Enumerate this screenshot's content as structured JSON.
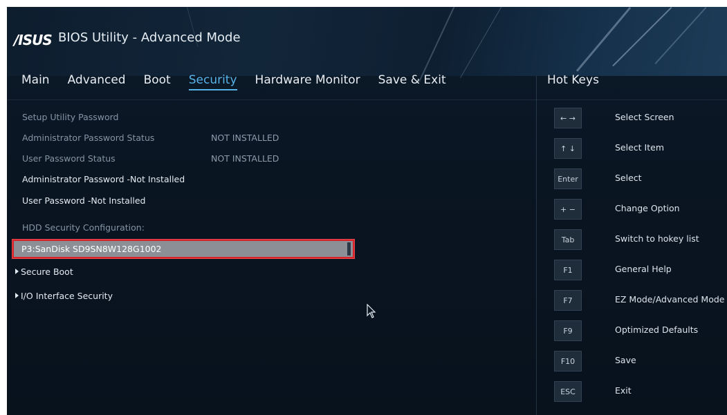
{
  "header": {
    "logo": "/ISUS",
    "title": "BIOS Utility - Advanced Mode"
  },
  "tabs": [
    {
      "label": "Main",
      "active": false
    },
    {
      "label": "Advanced",
      "active": false
    },
    {
      "label": "Boot",
      "active": false
    },
    {
      "label": "Security",
      "active": true
    },
    {
      "label": "Hardware Monitor",
      "active": false
    },
    {
      "label": "Save & Exit",
      "active": false
    }
  ],
  "security": {
    "setup_utility_password": "Setup Utility Password",
    "admin_status_label": "Administrator Password Status",
    "admin_status_value": "NOT INSTALLED",
    "user_status_label": "User Password Status",
    "user_status_value": "NOT INSTALLED",
    "admin_password": "Administrator Password -Not Installed",
    "user_password": "User Password -Not Installed",
    "hdd_config_label": "HDD Security Configuration:",
    "hdd_selected": "P3:SanDisk SD9SN8W128G1002",
    "secure_boot": "Secure Boot",
    "io_interface_security": "I/O Interface Security"
  },
  "hot_keys": {
    "title": "Hot Keys",
    "items": [
      {
        "key": "← →",
        "label": "Select Screen"
      },
      {
        "key": "↑ ↓",
        "label": "Select Item"
      },
      {
        "key": "Enter",
        "label": "Select"
      },
      {
        "key": "+ −",
        "label": "Change Option"
      },
      {
        "key": "Tab",
        "label": "Switch to hokey list"
      },
      {
        "key": "F1",
        "label": "General Help"
      },
      {
        "key": "F7",
        "label": "EZ Mode/Advanced Mode"
      },
      {
        "key": "F9",
        "label": "Optimized Defaults"
      },
      {
        "key": "F10",
        "label": "Save"
      },
      {
        "key": "ESC",
        "label": "Exit"
      }
    ]
  },
  "colors": {
    "accent": "#57b4ea",
    "selection_border": "#d8232a",
    "selection_bg": "#8c9096"
  }
}
